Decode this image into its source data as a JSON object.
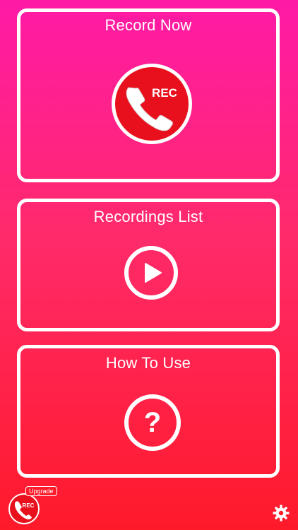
{
  "cards": {
    "record": {
      "title": "Record Now",
      "icon_label": "REC",
      "icon": "phone-rec-icon"
    },
    "list": {
      "title": "Recordings List",
      "icon": "play-icon"
    },
    "howto": {
      "title": "How To Use",
      "icon": "question-icon"
    }
  },
  "footer": {
    "upgrade_label": "Upgrade",
    "badge_label": "REC",
    "settings_icon": "gear-icon"
  },
  "colors": {
    "background_top": "#ff1aa6",
    "background_bottom": "#ff1a2a",
    "rec_red": "#e8101c",
    "white": "#ffffff"
  }
}
